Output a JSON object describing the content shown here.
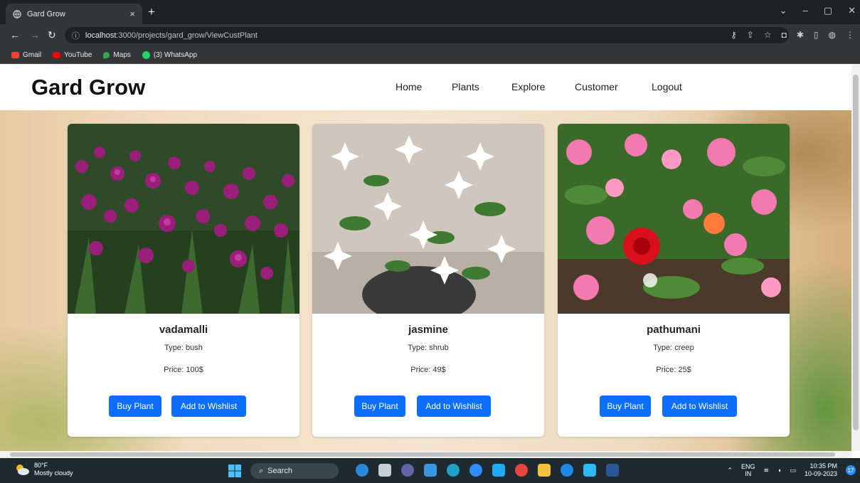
{
  "browser": {
    "tab_title": "Gard Grow",
    "tab_close": "×",
    "new_tab": "+",
    "url_host": "localhost",
    "url_path": ":3000/projects/gard_grow/ViewCustPlant",
    "bookmarks": [
      {
        "label": "Gmail",
        "color": "#ea4335"
      },
      {
        "label": "YouTube",
        "color": "#ff0000"
      },
      {
        "label": "Maps",
        "color": "#34a853"
      },
      {
        "label": "(3) WhatsApp",
        "color": "#25d366"
      }
    ]
  },
  "site": {
    "brand": "Gard Grow",
    "nav": [
      "Home",
      "Plants",
      "Explore",
      "Customer",
      "Logout"
    ]
  },
  "products": [
    {
      "name": "vadamalli",
      "type": "Type: bush",
      "price": "Price: 100$",
      "buy_label": "Buy Plant",
      "wishlist_label": "Add to Wishlist"
    },
    {
      "name": "jasmine",
      "type": "Type: shrub",
      "price": "Price: 49$",
      "buy_label": "Buy Plant",
      "wishlist_label": "Add to Wishlist"
    },
    {
      "name": "pathumani",
      "type": "Type: creep",
      "price": "Price: 25$",
      "buy_label": "Buy Plant",
      "wishlist_label": "Add to Wishlist"
    }
  ],
  "taskbar": {
    "weather_temp": "80°F",
    "weather_desc": "Mostly cloudy",
    "search_label": "Search",
    "lang_top": "ENG",
    "lang_bottom": "IN",
    "time": "10:35 PM",
    "date": "10-09-2023",
    "notification_count": "17"
  },
  "colors": {
    "accent": "#0d6efd"
  }
}
